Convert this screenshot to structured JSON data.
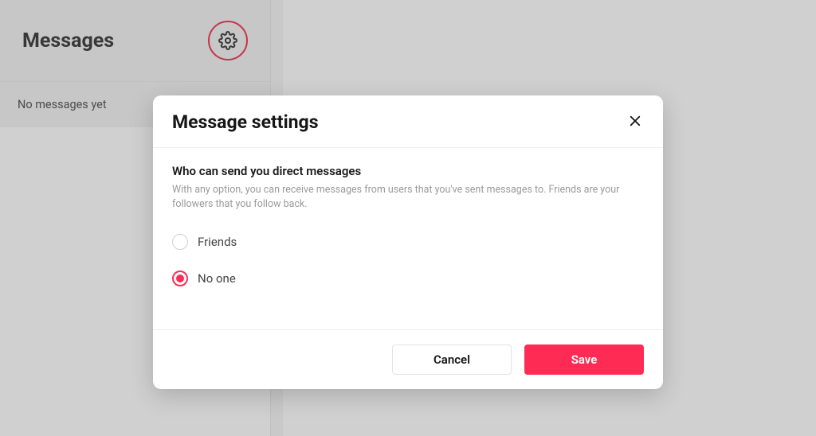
{
  "sidebar": {
    "title": "Messages",
    "empty_state": "No messages yet"
  },
  "modal": {
    "title": "Message settings",
    "section_title": "Who can send you direct messages",
    "section_desc": "With any option, you can receive messages from users that you've sent messages to. Friends are your followers that you follow back.",
    "options": [
      {
        "label": "Friends",
        "selected": false
      },
      {
        "label": "No one",
        "selected": true
      }
    ],
    "cancel": "Cancel",
    "save": "Save"
  }
}
